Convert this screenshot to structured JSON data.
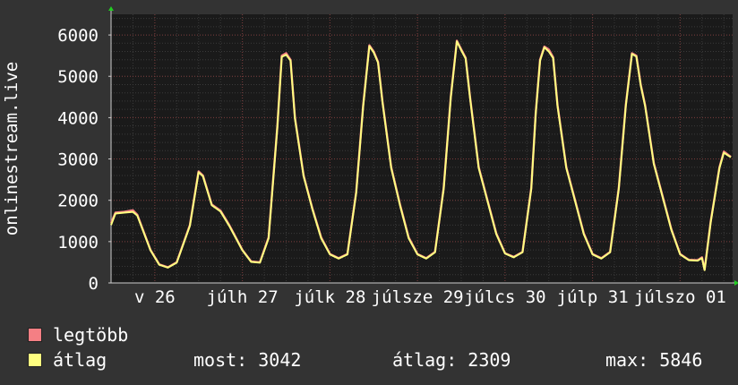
{
  "chart_data": {
    "type": "line",
    "ylabel": "onlinestream.live",
    "ylim": [
      0,
      6500
    ],
    "yticks": [
      0,
      1000,
      2000,
      3000,
      4000,
      5000,
      6000
    ],
    "ytick_labels": [
      "0",
      "1000",
      "2000",
      "3000",
      "4000",
      "5000",
      "6000"
    ],
    "x_range_days": [
      0,
      7.1
    ],
    "xticks": [
      {
        "day": 0.5,
        "label": "v 26"
      },
      {
        "day": 1.5,
        "label": "júlh 27"
      },
      {
        "day": 2.5,
        "label": "júlk 28"
      },
      {
        "day": 3.5,
        "label": "júlsze 29"
      },
      {
        "day": 4.5,
        "label": "júlcs 30"
      },
      {
        "day": 5.5,
        "label": "júlp 31"
      },
      {
        "day": 6.5,
        "label": "júlszo 01"
      }
    ],
    "series": [
      {
        "name": "legtöbb",
        "color": "#f47f84",
        "points": [
          [
            0,
            1450
          ],
          [
            0.05,
            1700
          ],
          [
            0.15,
            1720
          ],
          [
            0.25,
            1760
          ],
          [
            0.3,
            1650
          ],
          [
            0.45,
            800
          ],
          [
            0.55,
            450
          ],
          [
            0.65,
            380
          ],
          [
            0.75,
            500
          ],
          [
            0.9,
            1400
          ],
          [
            1.0,
            2700
          ],
          [
            1.05,
            2600
          ],
          [
            1.15,
            1900
          ],
          [
            1.25,
            1750
          ],
          [
            1.35,
            1400
          ],
          [
            1.5,
            800
          ],
          [
            1.6,
            520
          ],
          [
            1.7,
            500
          ],
          [
            1.8,
            1100
          ],
          [
            1.9,
            3800
          ],
          [
            1.95,
            5500
          ],
          [
            2.0,
            5560
          ],
          [
            2.05,
            5400
          ],
          [
            2.1,
            4000
          ],
          [
            2.2,
            2600
          ],
          [
            2.3,
            1800
          ],
          [
            2.4,
            1100
          ],
          [
            2.5,
            700
          ],
          [
            2.6,
            600
          ],
          [
            2.7,
            700
          ],
          [
            2.8,
            2200
          ],
          [
            2.88,
            4300
          ],
          [
            2.95,
            5750
          ],
          [
            3.0,
            5600
          ],
          [
            3.05,
            5350
          ],
          [
            3.1,
            4400
          ],
          [
            3.2,
            2800
          ],
          [
            3.3,
            1900
          ],
          [
            3.4,
            1100
          ],
          [
            3.5,
            700
          ],
          [
            3.6,
            600
          ],
          [
            3.7,
            750
          ],
          [
            3.8,
            2300
          ],
          [
            3.88,
            4500
          ],
          [
            3.95,
            5860
          ],
          [
            4.0,
            5650
          ],
          [
            4.05,
            5450
          ],
          [
            4.1,
            4500
          ],
          [
            4.2,
            2800
          ],
          [
            4.3,
            2000
          ],
          [
            4.4,
            1200
          ],
          [
            4.5,
            720
          ],
          [
            4.6,
            630
          ],
          [
            4.7,
            750
          ],
          [
            4.8,
            2300
          ],
          [
            4.85,
            4100
          ],
          [
            4.9,
            5400
          ],
          [
            4.95,
            5720
          ],
          [
            5.0,
            5650
          ],
          [
            5.05,
            5460
          ],
          [
            5.1,
            4300
          ],
          [
            5.2,
            2800
          ],
          [
            5.3,
            2000
          ],
          [
            5.4,
            1200
          ],
          [
            5.5,
            700
          ],
          [
            5.6,
            600
          ],
          [
            5.7,
            750
          ],
          [
            5.8,
            2300
          ],
          [
            5.88,
            4300
          ],
          [
            5.95,
            5560
          ],
          [
            6.0,
            5500
          ],
          [
            6.05,
            4800
          ],
          [
            6.1,
            4300
          ],
          [
            6.2,
            2900
          ],
          [
            6.3,
            2100
          ],
          [
            6.4,
            1300
          ],
          [
            6.5,
            700
          ],
          [
            6.6,
            560
          ],
          [
            6.7,
            550
          ],
          [
            6.75,
            620
          ],
          [
            6.78,
            320
          ],
          [
            6.85,
            1500
          ],
          [
            6.95,
            2800
          ],
          [
            7.0,
            3180
          ],
          [
            7.05,
            3100
          ],
          [
            7.08,
            3050
          ]
        ]
      },
      {
        "name": "átlag",
        "color": "#ffff80",
        "points": [
          [
            0,
            1400
          ],
          [
            0.05,
            1680
          ],
          [
            0.15,
            1700
          ],
          [
            0.25,
            1720
          ],
          [
            0.3,
            1630
          ],
          [
            0.45,
            790
          ],
          [
            0.55,
            440
          ],
          [
            0.65,
            370
          ],
          [
            0.75,
            490
          ],
          [
            0.9,
            1380
          ],
          [
            1.0,
            2680
          ],
          [
            1.05,
            2580
          ],
          [
            1.15,
            1880
          ],
          [
            1.25,
            1730
          ],
          [
            1.35,
            1380
          ],
          [
            1.5,
            790
          ],
          [
            1.6,
            510
          ],
          [
            1.7,
            490
          ],
          [
            1.8,
            1080
          ],
          [
            1.9,
            3780
          ],
          [
            1.95,
            5470
          ],
          [
            2.0,
            5520
          ],
          [
            2.05,
            5380
          ],
          [
            2.1,
            3980
          ],
          [
            2.2,
            2580
          ],
          [
            2.3,
            1780
          ],
          [
            2.4,
            1080
          ],
          [
            2.5,
            690
          ],
          [
            2.6,
            590
          ],
          [
            2.7,
            690
          ],
          [
            2.8,
            2180
          ],
          [
            2.88,
            4280
          ],
          [
            2.95,
            5730
          ],
          [
            3.0,
            5580
          ],
          [
            3.05,
            5330
          ],
          [
            3.1,
            4380
          ],
          [
            3.2,
            2780
          ],
          [
            3.3,
            1880
          ],
          [
            3.4,
            1080
          ],
          [
            3.5,
            690
          ],
          [
            3.6,
            590
          ],
          [
            3.7,
            740
          ],
          [
            3.8,
            2280
          ],
          [
            3.88,
            4480
          ],
          [
            3.95,
            5846
          ],
          [
            4.0,
            5630
          ],
          [
            4.05,
            5430
          ],
          [
            4.1,
            4480
          ],
          [
            4.2,
            2780
          ],
          [
            4.3,
            1980
          ],
          [
            4.4,
            1180
          ],
          [
            4.5,
            710
          ],
          [
            4.6,
            620
          ],
          [
            4.7,
            740
          ],
          [
            4.8,
            2280
          ],
          [
            4.85,
            4080
          ],
          [
            4.9,
            5380
          ],
          [
            4.95,
            5700
          ],
          [
            5.0,
            5600
          ],
          [
            5.05,
            5440
          ],
          [
            5.1,
            4280
          ],
          [
            5.2,
            2780
          ],
          [
            5.3,
            1980
          ],
          [
            5.4,
            1180
          ],
          [
            5.5,
            690
          ],
          [
            5.6,
            590
          ],
          [
            5.7,
            740
          ],
          [
            5.8,
            2280
          ],
          [
            5.88,
            4280
          ],
          [
            5.95,
            5540
          ],
          [
            6.0,
            5480
          ],
          [
            6.05,
            4780
          ],
          [
            6.1,
            4280
          ],
          [
            6.2,
            2880
          ],
          [
            6.3,
            2080
          ],
          [
            6.4,
            1280
          ],
          [
            6.5,
            690
          ],
          [
            6.6,
            550
          ],
          [
            6.7,
            540
          ],
          [
            6.75,
            600
          ],
          [
            6.78,
            310
          ],
          [
            6.85,
            1480
          ],
          [
            6.95,
            2780
          ],
          [
            7.0,
            3150
          ],
          [
            7.05,
            3080
          ],
          [
            7.08,
            3042
          ]
        ]
      }
    ],
    "legend": [
      {
        "label": "legtöbb",
        "color": "#f47f84"
      },
      {
        "label": "átlag",
        "color": "#ffff80"
      }
    ],
    "stats": {
      "now": "most: 3042",
      "avg": "átlag: 2309",
      "max": "max: 5846"
    },
    "grid": true
  }
}
